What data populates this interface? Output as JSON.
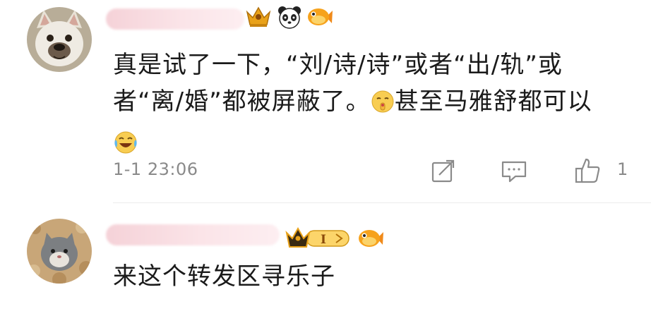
{
  "comments": [
    {
      "text": "真是试了一下，“刘/诗/诗”或者“出/轨”或者“离/婚”都被屏蔽了。",
      "text_after_emoji": "甚至马雅舒都可以",
      "timestamp": "1-1 23:06",
      "like_count": "1"
    },
    {
      "text": "来这个转发区寻乐子",
      "badge_level": "I"
    }
  ],
  "icons": {
    "share": "edit-share-icon",
    "comment": "comment-bubble-icon",
    "like": "thumbs-up-icon",
    "badges": [
      "gold-crown-badge-icon",
      "panda-icon",
      "goldfish-icon"
    ]
  },
  "colors": {
    "text": "#1a1a1a",
    "meta": "#8a8a8a",
    "gold": "#e9a21a",
    "name_blur": "#f5d2d8"
  }
}
